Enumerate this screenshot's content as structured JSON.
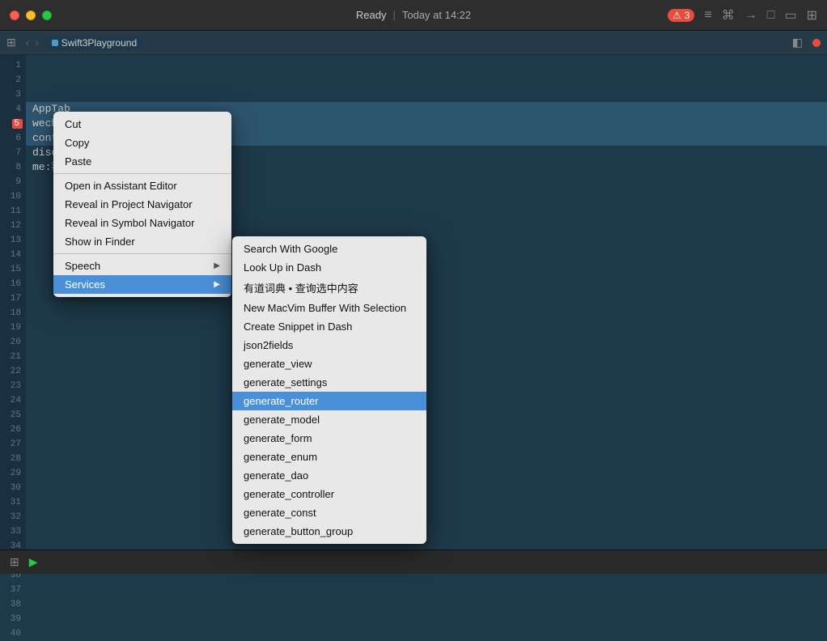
{
  "titlebar": {
    "status": "Ready",
    "separator": "|",
    "time": "Today at 14:22",
    "error_count": "3",
    "traffic_lights": {
      "close": "close",
      "minimize": "minimize",
      "maximize": "maximize"
    }
  },
  "toolbar_icons": [
    "≡",
    "⌘",
    "→",
    "□",
    "▭",
    "⊞"
  ],
  "tabs": {
    "items": [
      {
        "label": "Swift3Playground",
        "type": "swift"
      }
    ],
    "nav_back": "‹",
    "nav_forward": "›"
  },
  "editor": {
    "lines": [
      {
        "num": 1,
        "code": ""
      },
      {
        "num": 2,
        "code": ""
      },
      {
        "num": 3,
        "code": ""
      },
      {
        "num": 4,
        "code": "AppTab",
        "highlight": false
      },
      {
        "num": 5,
        "code": "wechat:微信",
        "highlight": true,
        "error": true
      },
      {
        "num": 6,
        "code": "conta",
        "highlight": false
      },
      {
        "num": 7,
        "code": "disco",
        "highlight": false
      },
      {
        "num": 8,
        "code": "me:我",
        "highlight": false
      }
    ]
  },
  "context_menu": {
    "items": [
      {
        "label": "Cut",
        "id": "cut",
        "has_submenu": false
      },
      {
        "label": "Copy",
        "id": "copy",
        "has_submenu": false
      },
      {
        "label": "Paste",
        "id": "paste",
        "has_submenu": false
      },
      {
        "separator": true
      },
      {
        "label": "Open in Assistant Editor",
        "id": "open-assistant",
        "has_submenu": false
      },
      {
        "label": "Reveal in Project Navigator",
        "id": "reveal-project",
        "has_submenu": false
      },
      {
        "label": "Reveal in Symbol Navigator",
        "id": "reveal-symbol",
        "has_submenu": false
      },
      {
        "label": "Show in Finder",
        "id": "show-finder",
        "has_submenu": false
      },
      {
        "separator": true
      },
      {
        "label": "Speech",
        "id": "speech",
        "has_submenu": true
      },
      {
        "label": "Services",
        "id": "services",
        "has_submenu": true,
        "active": true
      }
    ]
  },
  "submenu": {
    "items": [
      {
        "label": "Search With Google",
        "id": "search-google"
      },
      {
        "label": "Look Up in Dash",
        "id": "lookup-dash"
      },
      {
        "label": "有道词典 • 查询选中内容",
        "id": "youdao"
      },
      {
        "label": "New MacVim Buffer With Selection",
        "id": "macvim"
      },
      {
        "label": "Create Snippet in Dash",
        "id": "create-snippet"
      },
      {
        "label": "json2fields",
        "id": "json2fields"
      },
      {
        "label": "generate_view",
        "id": "generate-view"
      },
      {
        "label": "generate_settings",
        "id": "generate-settings"
      },
      {
        "label": "generate_router",
        "id": "generate-router",
        "highlighted": true
      },
      {
        "label": "generate_model",
        "id": "generate-model"
      },
      {
        "label": "generate_form",
        "id": "generate-form"
      },
      {
        "label": "generate_enum",
        "id": "generate-enum"
      },
      {
        "label": "generate_dao",
        "id": "generate-dao"
      },
      {
        "label": "generate_controller",
        "id": "generate-controller"
      },
      {
        "label": "generate_const",
        "id": "generate-const"
      },
      {
        "label": "generate_button_group",
        "id": "generate-button-group"
      }
    ]
  },
  "status_bar": {
    "play_icon": "▶"
  }
}
